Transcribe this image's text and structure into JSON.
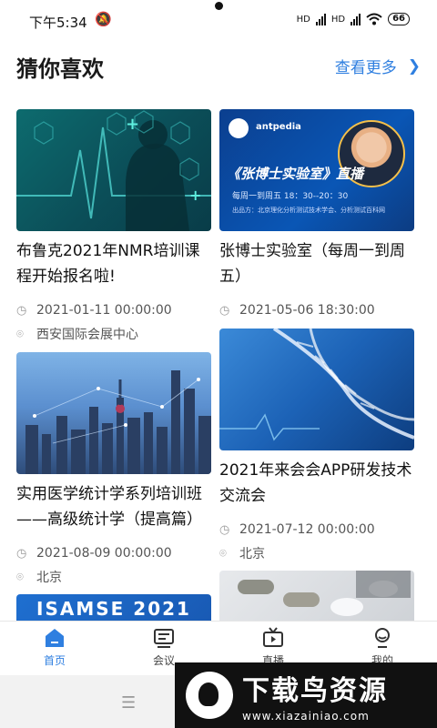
{
  "status_bar": {
    "time": "下午5:34",
    "battery": "66",
    "hd1": "HD",
    "hd2": "HD"
  },
  "section": {
    "title": "猜你喜欢",
    "more": "查看更多"
  },
  "cards": [
    {
      "title": "布鲁克2021年NMR培训课程开始报名啦!",
      "date": "2021-01-11 00:00:00",
      "location": "西安国际会展中心"
    },
    {
      "title": "张博士实验室（每周一到周五）",
      "date": "2021-05-06 18:30:00"
    },
    {
      "title": "实用医学统计学系列培训班——高级统计学（提高篇）",
      "date": "2021-08-09 00:00:00",
      "location": "北京"
    },
    {
      "title": "2021年来会会APP研发技术交流会",
      "date": "2021-07-12 00:00:00",
      "location": "北京"
    }
  ],
  "thumb_text": {
    "zhang_banner": "《张博士实验室》直播",
    "zhang_time": "每周一到周五  18：30--20：30",
    "zhang_org": "出品方：北京理化分析测试技术学会、分析测试百科网",
    "zhang_brand": "antpedia",
    "isamse": "ISAMSE 2021"
  },
  "nav": {
    "home": "首页",
    "meeting": "会议",
    "live": "直播",
    "mine": "我的"
  },
  "watermark": {
    "title": "下载鸟资源",
    "url": "www.xiazainiao.com"
  },
  "colors": {
    "accent": "#2f7fe0"
  }
}
